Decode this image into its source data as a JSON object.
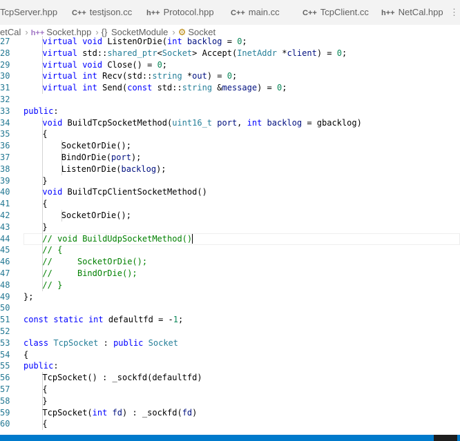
{
  "tabs": [
    {
      "label": "TcpServer.hpp",
      "kind": "h++",
      "active": false
    },
    {
      "label": "testjson.cc",
      "kind": "C++",
      "active": false
    },
    {
      "label": "Protocol.hpp",
      "kind": "h++",
      "active": false
    },
    {
      "label": "main.cc",
      "kind": "C++",
      "active": false
    },
    {
      "label": "TcpClient.cc",
      "kind": "C++",
      "active": false
    },
    {
      "label": "NetCal.hpp",
      "kind": "h++",
      "active": false
    }
  ],
  "breadcrumb": {
    "folder": "etCal",
    "file_icon": "h++",
    "file": "Socket.hpp",
    "scope_icon": "{}",
    "scope": "SocketModule",
    "symbol": "Socket"
  },
  "colors": {
    "keyword": "#0000ff",
    "type": "#267f99",
    "param": "#001080",
    "comment": "#008000",
    "number": "#098658",
    "line_number": "#237893",
    "statusbar": "#007acc"
  },
  "editor": {
    "lines": [
      {
        "n": "27",
        "indent": 2,
        "tokens": [
          [
            "kw",
            "virtual "
          ],
          [
            "kw",
            "void "
          ],
          [
            "",
            "ListenOrDie("
          ],
          [
            "kw",
            "int "
          ],
          [
            "pm",
            "backlog"
          ],
          [
            "",
            " = "
          ],
          [
            "nu",
            "0"
          ],
          [
            "",
            ";"
          ]
        ]
      },
      {
        "n": "28",
        "indent": 2,
        "tokens": [
          [
            "kw",
            "virtual "
          ],
          [
            "",
            "std::"
          ],
          [
            "ty",
            "shared_ptr"
          ],
          [
            "",
            "<"
          ],
          [
            "ty",
            "Socket"
          ],
          [
            "",
            "> Accept("
          ],
          [
            "ty",
            "InetAddr "
          ],
          [
            "",
            "*"
          ],
          [
            "pm",
            "client"
          ],
          [
            "",
            ") = "
          ],
          [
            "nu",
            "0"
          ],
          [
            "",
            ";"
          ]
        ]
      },
      {
        "n": "29",
        "indent": 2,
        "tokens": [
          [
            "kw",
            "virtual "
          ],
          [
            "kw",
            "void "
          ],
          [
            "",
            "Close() = "
          ],
          [
            "nu",
            "0"
          ],
          [
            "",
            ";"
          ]
        ]
      },
      {
        "n": "30",
        "indent": 2,
        "tokens": [
          [
            "kw",
            "virtual "
          ],
          [
            "kw",
            "int "
          ],
          [
            "",
            "Recv(std::"
          ],
          [
            "ty",
            "string "
          ],
          [
            "",
            "*"
          ],
          [
            "pm",
            "out"
          ],
          [
            "",
            ") = "
          ],
          [
            "nu",
            "0"
          ],
          [
            "",
            ";"
          ]
        ]
      },
      {
        "n": "31",
        "indent": 2,
        "tokens": [
          [
            "kw",
            "virtual "
          ],
          [
            "kw",
            "int "
          ],
          [
            "",
            "Send("
          ],
          [
            "kw",
            "const "
          ],
          [
            "",
            "std::"
          ],
          [
            "ty",
            "string "
          ],
          [
            "",
            "&"
          ],
          [
            "pm",
            "message"
          ],
          [
            "",
            ") = "
          ],
          [
            "nu",
            "0"
          ],
          [
            "",
            ";"
          ]
        ]
      },
      {
        "n": "32",
        "indent": 0,
        "tokens": []
      },
      {
        "n": "33",
        "indent": 1,
        "tokens": [
          [
            "kw",
            "public"
          ],
          [
            "",
            ":"
          ]
        ]
      },
      {
        "n": "34",
        "indent": 2,
        "tokens": [
          [
            "kw",
            "void "
          ],
          [
            "",
            "BuildTcpSocketMethod("
          ],
          [
            "ty",
            "uint16_t "
          ],
          [
            "pm",
            "port"
          ],
          [
            "",
            ", "
          ],
          [
            "kw",
            "int "
          ],
          [
            "pm",
            "backlog"
          ],
          [
            "",
            " = gbacklog)"
          ]
        ]
      },
      {
        "n": "35",
        "indent": 2,
        "tokens": [
          [
            "",
            "{"
          ]
        ]
      },
      {
        "n": "36",
        "indent": 3,
        "tokens": [
          [
            "",
            "SocketOrDie();"
          ]
        ]
      },
      {
        "n": "37",
        "indent": 3,
        "tokens": [
          [
            "",
            "BindOrDie("
          ],
          [
            "pm",
            "port"
          ],
          [
            "",
            ");"
          ]
        ]
      },
      {
        "n": "38",
        "indent": 3,
        "tokens": [
          [
            "",
            "ListenOrDie("
          ],
          [
            "pm",
            "backlog"
          ],
          [
            "",
            ");"
          ]
        ]
      },
      {
        "n": "39",
        "indent": 2,
        "tokens": [
          [
            "",
            "}"
          ]
        ]
      },
      {
        "n": "40",
        "indent": 2,
        "tokens": [
          [
            "kw",
            "void "
          ],
          [
            "",
            "BuildTcpClientSocketMethod()"
          ]
        ]
      },
      {
        "n": "41",
        "indent": 2,
        "tokens": [
          [
            "",
            "{"
          ]
        ]
      },
      {
        "n": "42",
        "indent": 3,
        "tokens": [
          [
            "",
            "SocketOrDie();"
          ]
        ]
      },
      {
        "n": "43",
        "indent": 2,
        "tokens": [
          [
            "",
            "}"
          ]
        ]
      },
      {
        "n": "44",
        "indent": 2,
        "tokens": [
          [
            "cm",
            "// void BuildUdpSocketMethod()"
          ]
        ],
        "cursor": true
      },
      {
        "n": "45",
        "indent": 2,
        "tokens": [
          [
            "cm",
            "// {"
          ]
        ]
      },
      {
        "n": "46",
        "indent": 2,
        "tokens": [
          [
            "cm",
            "//     SocketOrDie();"
          ]
        ]
      },
      {
        "n": "47",
        "indent": 2,
        "tokens": [
          [
            "cm",
            "//     BindOrDie();"
          ]
        ]
      },
      {
        "n": "48",
        "indent": 2,
        "tokens": [
          [
            "cm",
            "// }"
          ]
        ]
      },
      {
        "n": "49",
        "indent": 1,
        "tokens": [
          [
            "",
            "};"
          ]
        ]
      },
      {
        "n": "50",
        "indent": 0,
        "tokens": []
      },
      {
        "n": "51",
        "indent": 1,
        "tokens": [
          [
            "kw",
            "const "
          ],
          [
            "kw",
            "static "
          ],
          [
            "kw",
            "int "
          ],
          [
            "",
            "defaultfd = -"
          ],
          [
            "nu",
            "1"
          ],
          [
            "",
            ";"
          ]
        ]
      },
      {
        "n": "52",
        "indent": 0,
        "tokens": []
      },
      {
        "n": "53",
        "indent": 1,
        "tokens": [
          [
            "kw",
            "class "
          ],
          [
            "ty",
            "TcpSocket "
          ],
          [
            "",
            ": "
          ],
          [
            "kw",
            "public "
          ],
          [
            "ty",
            "Socket"
          ]
        ]
      },
      {
        "n": "54",
        "indent": 1,
        "tokens": [
          [
            "",
            "{"
          ]
        ]
      },
      {
        "n": "55",
        "indent": 1,
        "tokens": [
          [
            "kw",
            "public"
          ],
          [
            "",
            ":"
          ]
        ]
      },
      {
        "n": "56",
        "indent": 2,
        "tokens": [
          [
            "",
            "TcpSocket() : _sockfd(defaultfd)"
          ]
        ]
      },
      {
        "n": "57",
        "indent": 2,
        "tokens": [
          [
            "",
            "{"
          ]
        ]
      },
      {
        "n": "58",
        "indent": 2,
        "tokens": [
          [
            "",
            "}"
          ]
        ]
      },
      {
        "n": "59",
        "indent": 2,
        "tokens": [
          [
            "",
            "TcpSocket("
          ],
          [
            "kw",
            "int "
          ],
          [
            "pm",
            "fd"
          ],
          [
            "",
            ") : _sockfd("
          ],
          [
            "pm",
            "fd"
          ],
          [
            "",
            ")"
          ]
        ]
      },
      {
        "n": "60",
        "indent": 2,
        "tokens": [
          [
            "",
            "{"
          ]
        ]
      }
    ]
  }
}
